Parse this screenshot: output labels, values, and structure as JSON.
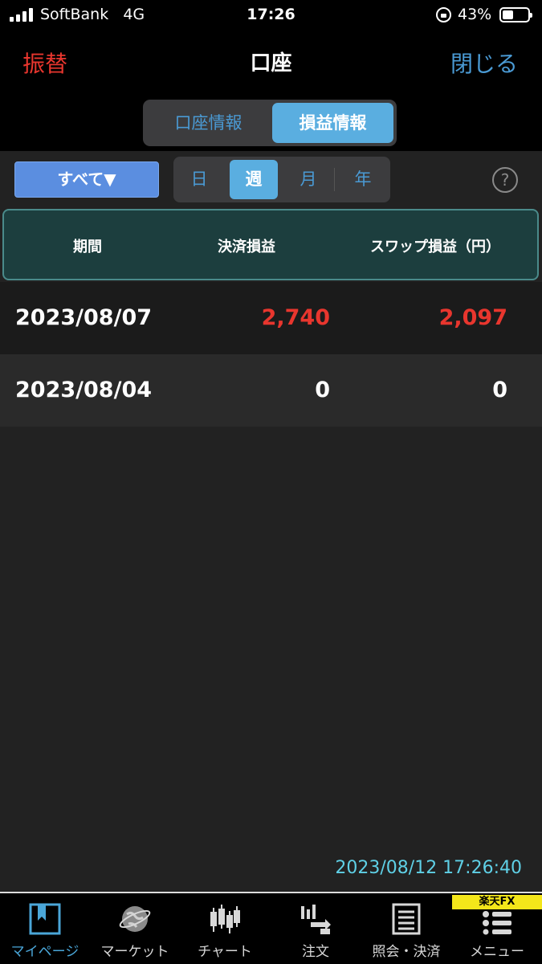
{
  "status_bar": {
    "carrier": "SoftBank",
    "network": "4G",
    "time": "17:26",
    "battery": "43%"
  },
  "nav": {
    "left": "振替",
    "title": "口座",
    "right": "閉じる"
  },
  "tabs_top": [
    "口座情報",
    "損益情報"
  ],
  "filter": {
    "label": "すべて▼"
  },
  "periods": [
    "日",
    "週",
    "月",
    "年"
  ],
  "help": "?",
  "table": {
    "headers": [
      "期間",
      "決済損益",
      "スワップ損益（円）"
    ],
    "rows": [
      {
        "date": "2023/08/07",
        "pl": "2,740",
        "swap": "2,097"
      },
      {
        "date": "2023/08/04",
        "pl": "0",
        "swap": "0"
      }
    ]
  },
  "timestamp": "2023/08/12 17:26:40",
  "bottom_tabs": [
    {
      "label": "マイページ",
      "icon": "bookmark-icon"
    },
    {
      "label": "マーケット",
      "icon": "globe-icon"
    },
    {
      "label": "チャート",
      "icon": "candlestick-icon"
    },
    {
      "label": "注文",
      "icon": "order-arrows-icon"
    },
    {
      "label": "照会・決済",
      "icon": "document-list-icon"
    },
    {
      "label": "メニュー",
      "icon": "menu-list-icon"
    }
  ],
  "brand": "楽天FX",
  "colors": {
    "accent_blue": "#4a9ad4",
    "active_blue": "#5aaee0",
    "loss_red": "#e8362e",
    "timestamp_cyan": "#5fd0e6",
    "header_teal": "#1c3e3e"
  }
}
